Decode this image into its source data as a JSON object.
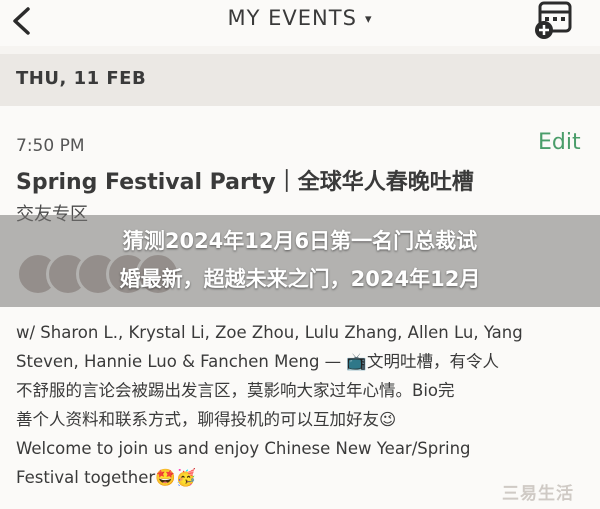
{
  "header": {
    "title": "MY EVENTS",
    "title_chevron": "▾",
    "back_icon": "back-chevron",
    "calendar_icon": "calendar-add"
  },
  "date_header": "THU, 11 FEB",
  "event": {
    "time": "7:50 PM",
    "edit_label": "Edit",
    "title": "Spring Festival Party｜全球华人春晚吐槽",
    "title_cont": "交友专区",
    "description_lines": [
      "w/ Sharon L., Krystal Li, Zoe Zhou, Lulu Zhang, Allen Lu, Yang",
      "Steven, Hannie Luo & Fanchen Meng — 📺文明吐槽，有令人",
      "不舒服的言论会被踢出发言区，莫影响大家过年心情。Bio完",
      "善个人资料和联系方式，聊得投机的可以互加好友😉",
      "Welcome to join us and enjoy Chinese New Year/Spring",
      "Festival together🤩🥳"
    ]
  },
  "overlay": {
    "line1": "猜测2024年12月6日第一名门总裁试",
    "line2": "婚最新，超越未来之门，2024年12月"
  },
  "watermark": "三易生活"
}
